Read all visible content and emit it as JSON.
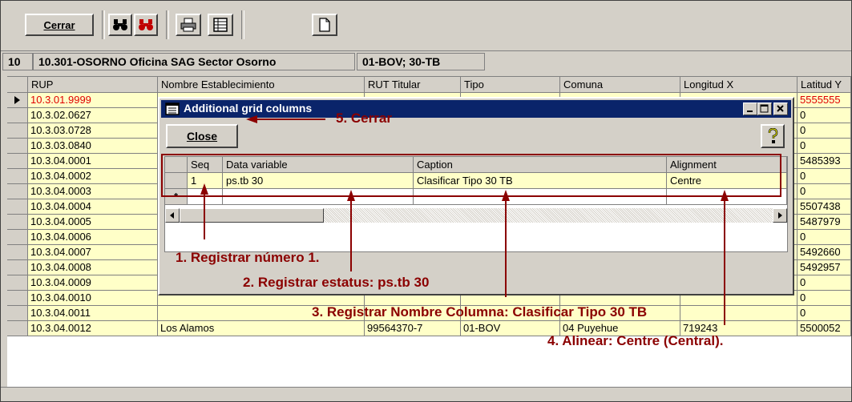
{
  "toolbar": {
    "close_label": "Cerrar",
    "icons": [
      "binoculars-icon",
      "binoculars-red-icon",
      "printer-icon",
      "grid-icon",
      "new-document-icon"
    ]
  },
  "infobar": {
    "number": "10",
    "office": "10.301-OSORNO Oficina SAG Sector Osorno",
    "codes": "01-BOV; 30-TB"
  },
  "grid": {
    "headers": [
      "RUP",
      "Nombre Establecimiento",
      "RUT Titular",
      "Tipo",
      "Comuna",
      "Longitud X",
      "Latitud Y"
    ],
    "rows": [
      {
        "rup": "10.3.01.9999",
        "lat": "5555555"
      },
      {
        "rup": "10.3.02.0627",
        "lat": "0"
      },
      {
        "rup": "10.3.03.0728",
        "lat": "0"
      },
      {
        "rup": "10.3.03.0840",
        "lat": "0"
      },
      {
        "rup": "10.3.04.0001",
        "lat": "5485393"
      },
      {
        "rup": "10.3.04.0002",
        "lat": "0"
      },
      {
        "rup": "10.3.04.0003",
        "lat": "0"
      },
      {
        "rup": "10.3.04.0004",
        "lat": "5507438"
      },
      {
        "rup": "10.3.04.0005",
        "lat": "5487979"
      },
      {
        "rup": "10.3.04.0006",
        "lat": "0"
      },
      {
        "rup": "10.3.04.0007",
        "lat": "5492660"
      },
      {
        "rup": "10.3.04.0008",
        "lat": "5492957"
      },
      {
        "rup": "10.3.04.0009",
        "lat": "0"
      },
      {
        "rup": "10.3.04.0010",
        "lat": "0"
      },
      {
        "rup": "10.3.04.0011",
        "lat": "0"
      },
      {
        "rup": "10.3.04.0012",
        "name": "Los Alamos",
        "rut": "99564370-7",
        "tipo": "01-BOV",
        "comuna": "04 Puyehue",
        "lon": "719243",
        "lat": "5500052"
      }
    ]
  },
  "dialog": {
    "title": "Additional grid columns",
    "close_label": "Close",
    "headers": [
      "Seq",
      "Data variable",
      "Caption",
      "Alignment"
    ],
    "row": {
      "seq": "1",
      "variable": "ps.tb 30",
      "caption": "Clasificar Tipo 30 TB",
      "alignment": "Centre"
    },
    "new_row_marker": "*"
  },
  "annotations": {
    "a5": "5. Cerrar",
    "a1": "1. Registrar número 1.",
    "a2": "2. Registrar estatus: ps.tb 30",
    "a3": "3. Registrar Nombre Columna: Clasificar Tipo 30 TB",
    "a4": "4. Alinear: Centre (Central)."
  },
  "colors": {
    "accent": "#8b0000",
    "title_bar": "#0a246a",
    "row_bg": "#ffffc8",
    "highlight_text": "#e00000"
  }
}
